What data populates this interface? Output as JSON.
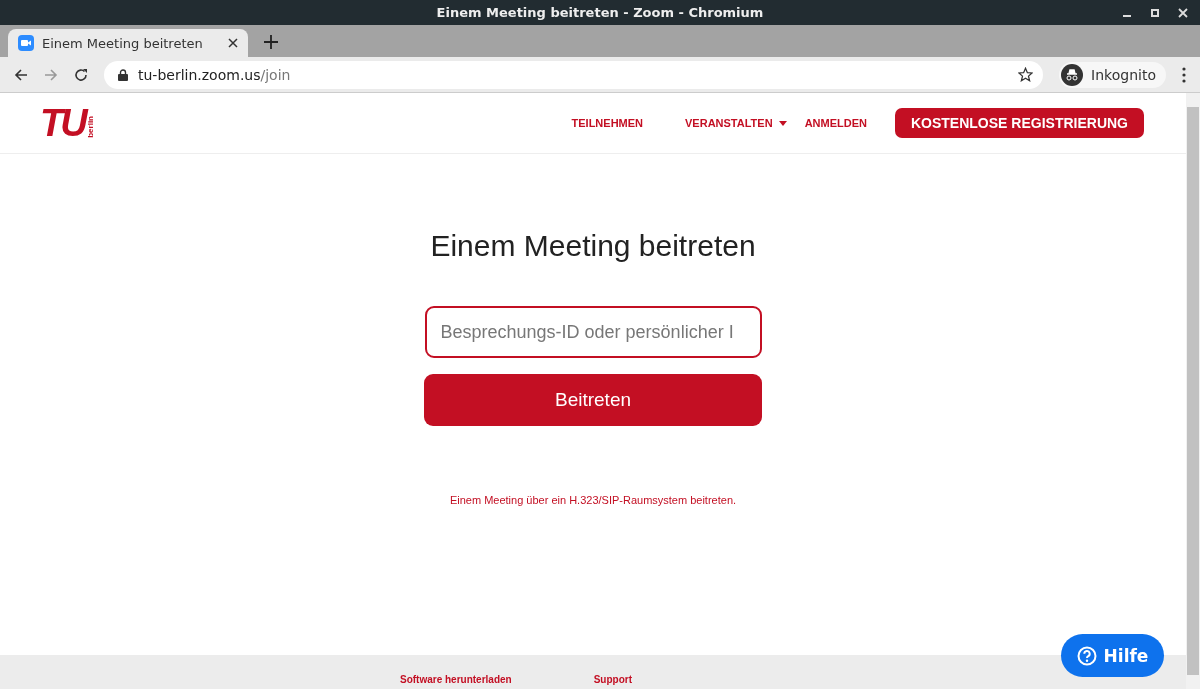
{
  "window": {
    "title": "Einem Meeting beitreten - Zoom - Chromium"
  },
  "tabs": [
    {
      "label": "Einem Meeting beitreten",
      "selected": true
    }
  ],
  "address_bar": {
    "host": "tu-berlin.zoom.us",
    "path": "/join"
  },
  "profile": {
    "label": "Inkognito"
  },
  "logo": {
    "letters": "TU",
    "sub": "berlin"
  },
  "nav": [
    {
      "label": "TEILNEHMEN",
      "kind": "link"
    },
    {
      "label": "VERANSTALTEN",
      "kind": "dropdown"
    },
    {
      "label": "ANMELDEN",
      "kind": "link"
    },
    {
      "label": "KOSTENLOSE REGISTRIERUNG",
      "kind": "button"
    }
  ],
  "heading": "Einem Meeting beitreten",
  "meeting_id_field": {
    "placeholder": "Besprechungs-ID oder persönlicher I"
  },
  "join_button": "Beitreten",
  "room_system_link": "Einem Meeting über ein H.323/SIP-Raumsystem beitreten.",
  "help_button": "Hilfe",
  "footer": [
    "Software herunterladen",
    "Support"
  ]
}
